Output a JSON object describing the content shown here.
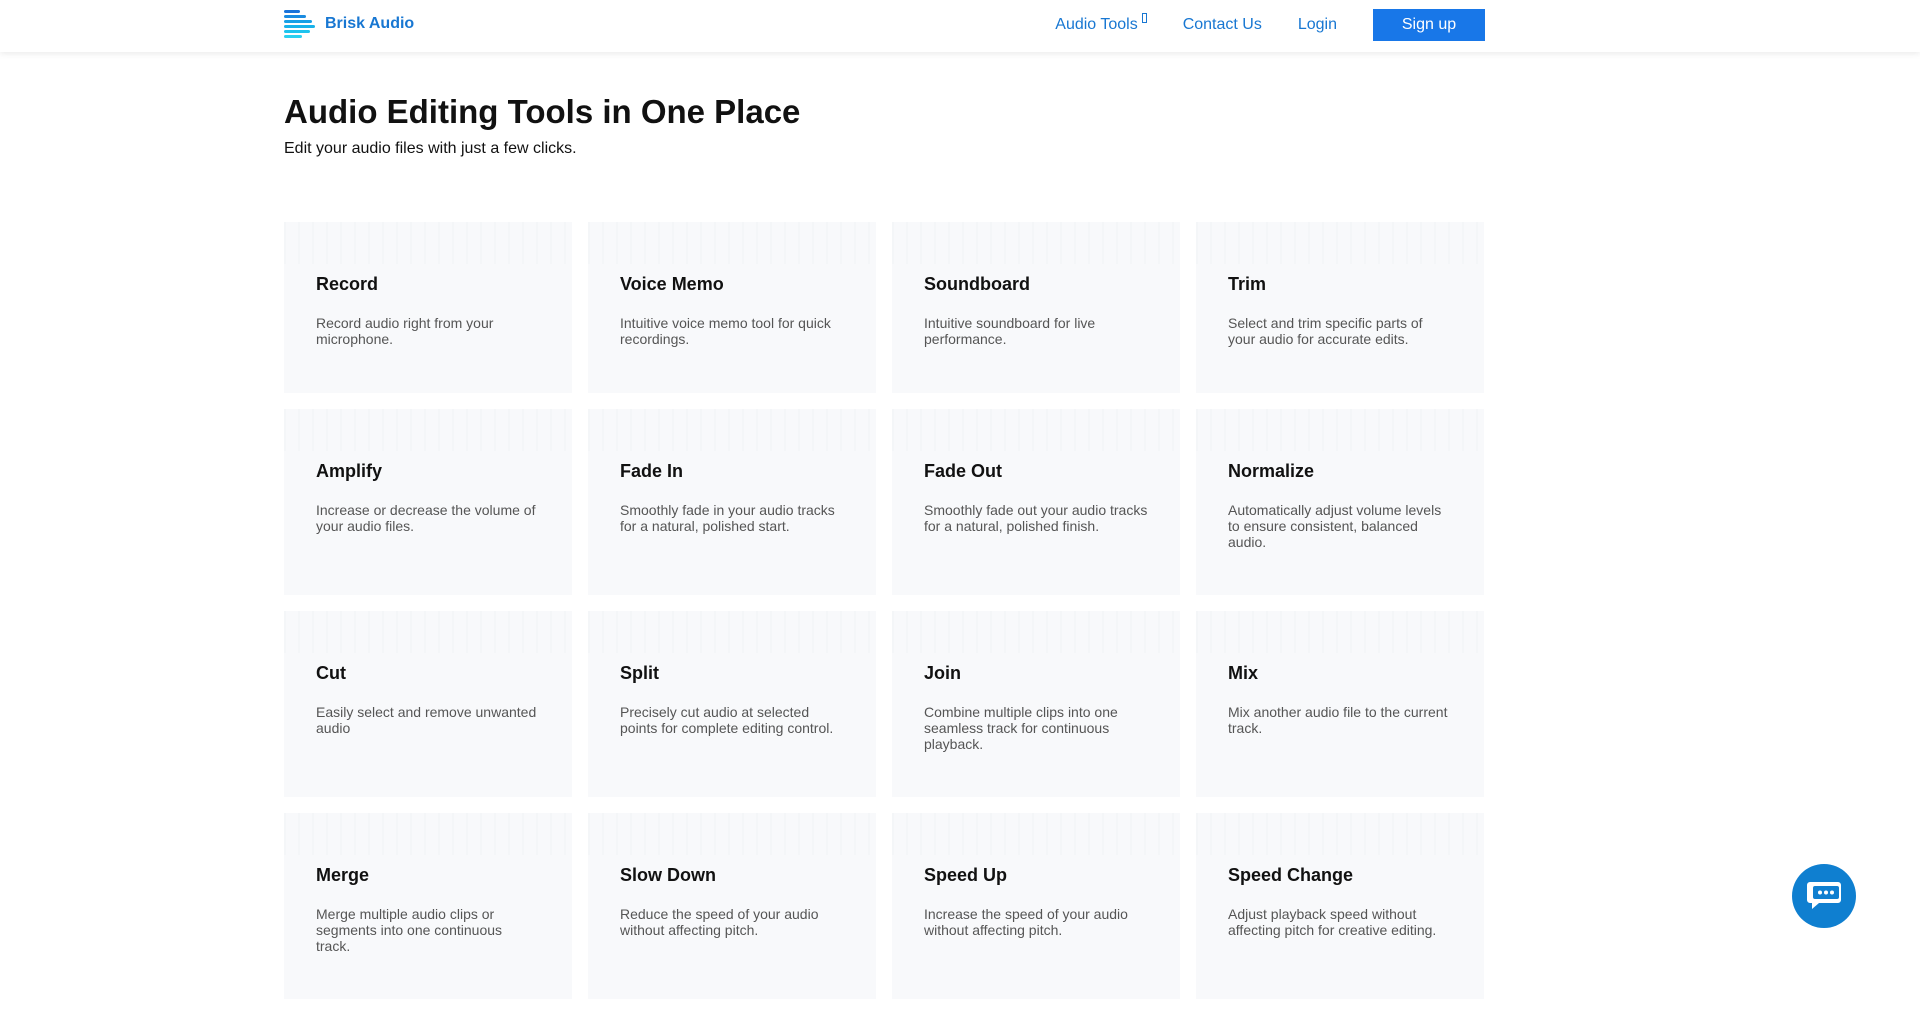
{
  "brand": {
    "name": "Brisk Audio",
    "accent": "#1877d2",
    "button_color": "#1877e8"
  },
  "nav": {
    "items": [
      {
        "label": "Audio Tools",
        "has_dropdown": true
      },
      {
        "label": "Contact Us"
      },
      {
        "label": "Login"
      }
    ],
    "signup_label": "Sign up"
  },
  "hero": {
    "title": "Audio Editing Tools in One Place",
    "subtitle": "Edit your audio files with just a few clicks."
  },
  "tools": [
    {
      "title": "Record",
      "desc": "Record audio right from your microphone."
    },
    {
      "title": "Voice Memo",
      "desc": "Intuitive voice memo tool for quick recordings."
    },
    {
      "title": "Soundboard",
      "desc": "Intuitive soundboard for live performance."
    },
    {
      "title": "Trim",
      "desc": "Select and trim specific parts of your audio for accurate edits."
    },
    {
      "title": "Amplify",
      "desc": "Increase or decrease the volume of your audio files."
    },
    {
      "title": "Fade In",
      "desc": "Smoothly fade in your audio tracks for a natural, polished start."
    },
    {
      "title": "Fade Out",
      "desc": "Smoothly fade out your audio tracks for a natural, polished finish."
    },
    {
      "title": "Normalize",
      "desc": "Automatically adjust volume levels to ensure consistent, balanced audio."
    },
    {
      "title": "Cut",
      "desc": "Easily select and remove unwanted audio"
    },
    {
      "title": "Split",
      "desc": "Precisely cut audio at selected points for complete editing control."
    },
    {
      "title": "Join",
      "desc": "Combine multiple clips into one seamless track for continuous playback."
    },
    {
      "title": "Mix",
      "desc": "Mix another audio file to the current track."
    },
    {
      "title": "Merge",
      "desc": "Merge multiple audio clips or segments into one continuous track."
    },
    {
      "title": "Slow Down",
      "desc": "Reduce the speed of your audio without affecting pitch."
    },
    {
      "title": "Speed Up",
      "desc": "Increase the speed of your audio without affecting pitch."
    },
    {
      "title": "Speed Change",
      "desc": "Adjust playback speed without affecting pitch for creative editing."
    }
  ],
  "chat": {
    "icon": "chat-bubble-icon",
    "color": "#0f7fd0"
  }
}
